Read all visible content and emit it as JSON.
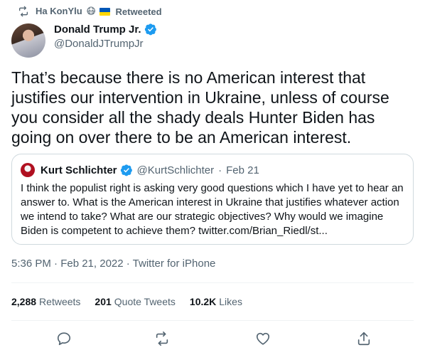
{
  "retweet_context": {
    "user": "Ha KonYlu",
    "emoji": "😷",
    "label": "Retweeted"
  },
  "author": {
    "name": "Donald Trump Jr.",
    "handle": "@DonaldJTrumpJr"
  },
  "tweet": {
    "text": "That’s because there is no American interest that justifies our intervention in Ukraine, unless of course you consider all the shady deals Hunter Biden has going on over there to be an American interest.",
    "timestamp": "5:36 PM · Feb 21, 2022 · Twitter for iPhone"
  },
  "quote": {
    "name": "Kurt Schlichter",
    "handle": "@KurtSchlichter",
    "separator": "·",
    "date": "Feb 21",
    "text": "I think the populist right is asking very good questions which I have yet to hear an answer to. What is the American interest in Ukraine that justifies whatever action we intend to take? What are our strategic objectives? Why would we imagine Biden is competent to achieve them? twitter.com/Brian_Riedl/st..."
  },
  "stats": [
    {
      "value": "2,288",
      "label": "Retweets"
    },
    {
      "value": "201",
      "label": "Quote Tweets"
    },
    {
      "value": "10.2K",
      "label": "Likes"
    }
  ],
  "actions": {
    "icons": [
      "reply-icon",
      "retweet-icon",
      "like-icon",
      "share-icon"
    ]
  },
  "colors": {
    "verified": "#1d9bf0",
    "secondary_text": "#536471",
    "primary_text": "#0f1419",
    "border": "#cfd9de"
  }
}
